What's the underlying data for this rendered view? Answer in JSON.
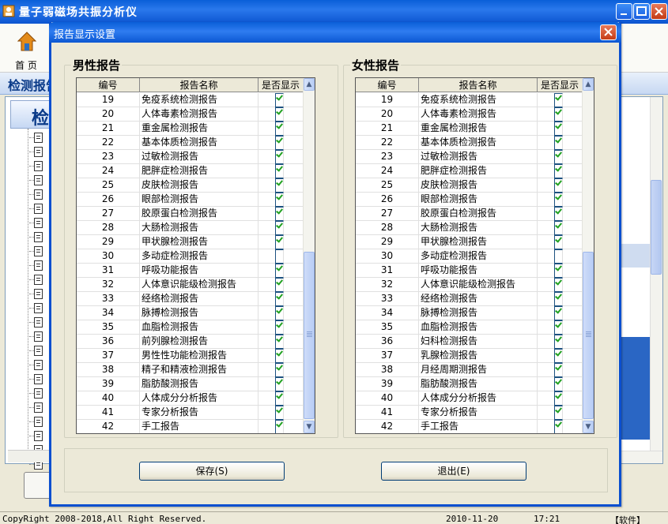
{
  "window": {
    "title": "量子弱磁场共振分析仪"
  },
  "toolbar": {
    "home_label": "首 页"
  },
  "section": {
    "title": "检测报告"
  },
  "status": {
    "copyright": "CopyRight 2008-2018,All Right Reserved.",
    "date": "2010-11-20",
    "time": "17:21",
    "software": "【软件】"
  },
  "dialog": {
    "title": "报告显示设置",
    "columns": {
      "no": "编号",
      "name": "报告名称",
      "show": "是否显示"
    },
    "male": {
      "label": "男性报告",
      "rows": [
        {
          "no": "19",
          "name": "免疫系统检测报告",
          "show": true
        },
        {
          "no": "20",
          "name": "人体毒素检测报告",
          "show": true
        },
        {
          "no": "21",
          "name": "重金属检测报告",
          "show": true
        },
        {
          "no": "22",
          "name": "基本体质检测报告",
          "show": true
        },
        {
          "no": "23",
          "name": "过敏检测报告",
          "show": true
        },
        {
          "no": "24",
          "name": "肥胖症检测报告",
          "show": true
        },
        {
          "no": "25",
          "name": "皮肤检测报告",
          "show": true
        },
        {
          "no": "26",
          "name": "眼部检测报告",
          "show": true
        },
        {
          "no": "27",
          "name": "胶原蛋白检测报告",
          "show": true
        },
        {
          "no": "28",
          "name": "大肠检测报告",
          "show": true
        },
        {
          "no": "29",
          "name": "甲状腺检测报告",
          "show": true
        },
        {
          "no": "30",
          "name": "多动症检测报告",
          "show": false
        },
        {
          "no": "31",
          "name": "呼吸功能报告",
          "show": true
        },
        {
          "no": "32",
          "name": "人体意识能级检测报告",
          "show": true
        },
        {
          "no": "33",
          "name": "经络检测报告",
          "show": true
        },
        {
          "no": "34",
          "name": "脉搏检测报告",
          "show": true
        },
        {
          "no": "35",
          "name": "血脂检测报告",
          "show": true
        },
        {
          "no": "36",
          "name": "前列腺检测报告",
          "show": true
        },
        {
          "no": "37",
          "name": "男性性功能检测报告",
          "show": true
        },
        {
          "no": "38",
          "name": "精子和精液检测报告",
          "show": true
        },
        {
          "no": "39",
          "name": "脂肪酸测报告",
          "show": true
        },
        {
          "no": "40",
          "name": "人体成分分析报告",
          "show": true
        },
        {
          "no": "41",
          "name": "专家分析报告",
          "show": true
        },
        {
          "no": "42",
          "name": "手工报告",
          "show": true
        }
      ]
    },
    "female": {
      "label": "女性报告",
      "rows": [
        {
          "no": "19",
          "name": "免疫系统检测报告",
          "show": true
        },
        {
          "no": "20",
          "name": "人体毒素检测报告",
          "show": true
        },
        {
          "no": "21",
          "name": "重金属检测报告",
          "show": true
        },
        {
          "no": "22",
          "name": "基本体质检测报告",
          "show": true
        },
        {
          "no": "23",
          "name": "过敏检测报告",
          "show": true
        },
        {
          "no": "24",
          "name": "肥胖症检测报告",
          "show": true
        },
        {
          "no": "25",
          "name": "皮肤检测报告",
          "show": true
        },
        {
          "no": "26",
          "name": "眼部检测报告",
          "show": true
        },
        {
          "no": "27",
          "name": "胶原蛋白检测报告",
          "show": true
        },
        {
          "no": "28",
          "name": "大肠检测报告",
          "show": true
        },
        {
          "no": "29",
          "name": "甲状腺检测报告",
          "show": true
        },
        {
          "no": "30",
          "name": "多动症检测报告",
          "show": false
        },
        {
          "no": "31",
          "name": "呼吸功能报告",
          "show": true
        },
        {
          "no": "32",
          "name": "人体意识能级检测报告",
          "show": true
        },
        {
          "no": "33",
          "name": "经络检测报告",
          "show": true
        },
        {
          "no": "34",
          "name": "脉搏检测报告",
          "show": true
        },
        {
          "no": "35",
          "name": "血脂检测报告",
          "show": true
        },
        {
          "no": "36",
          "name": "妇科检测报告",
          "show": true
        },
        {
          "no": "37",
          "name": "乳腺检测报告",
          "show": true
        },
        {
          "no": "38",
          "name": "月经周期测报告",
          "show": true
        },
        {
          "no": "39",
          "name": "脂肪酸测报告",
          "show": true
        },
        {
          "no": "40",
          "name": "人体成分分析报告",
          "show": true
        },
        {
          "no": "41",
          "name": "专家分析报告",
          "show": true
        },
        {
          "no": "42",
          "name": "手工报告",
          "show": true
        }
      ]
    },
    "buttons": {
      "save": "保存(S)",
      "exit": "退出(E)"
    }
  }
}
